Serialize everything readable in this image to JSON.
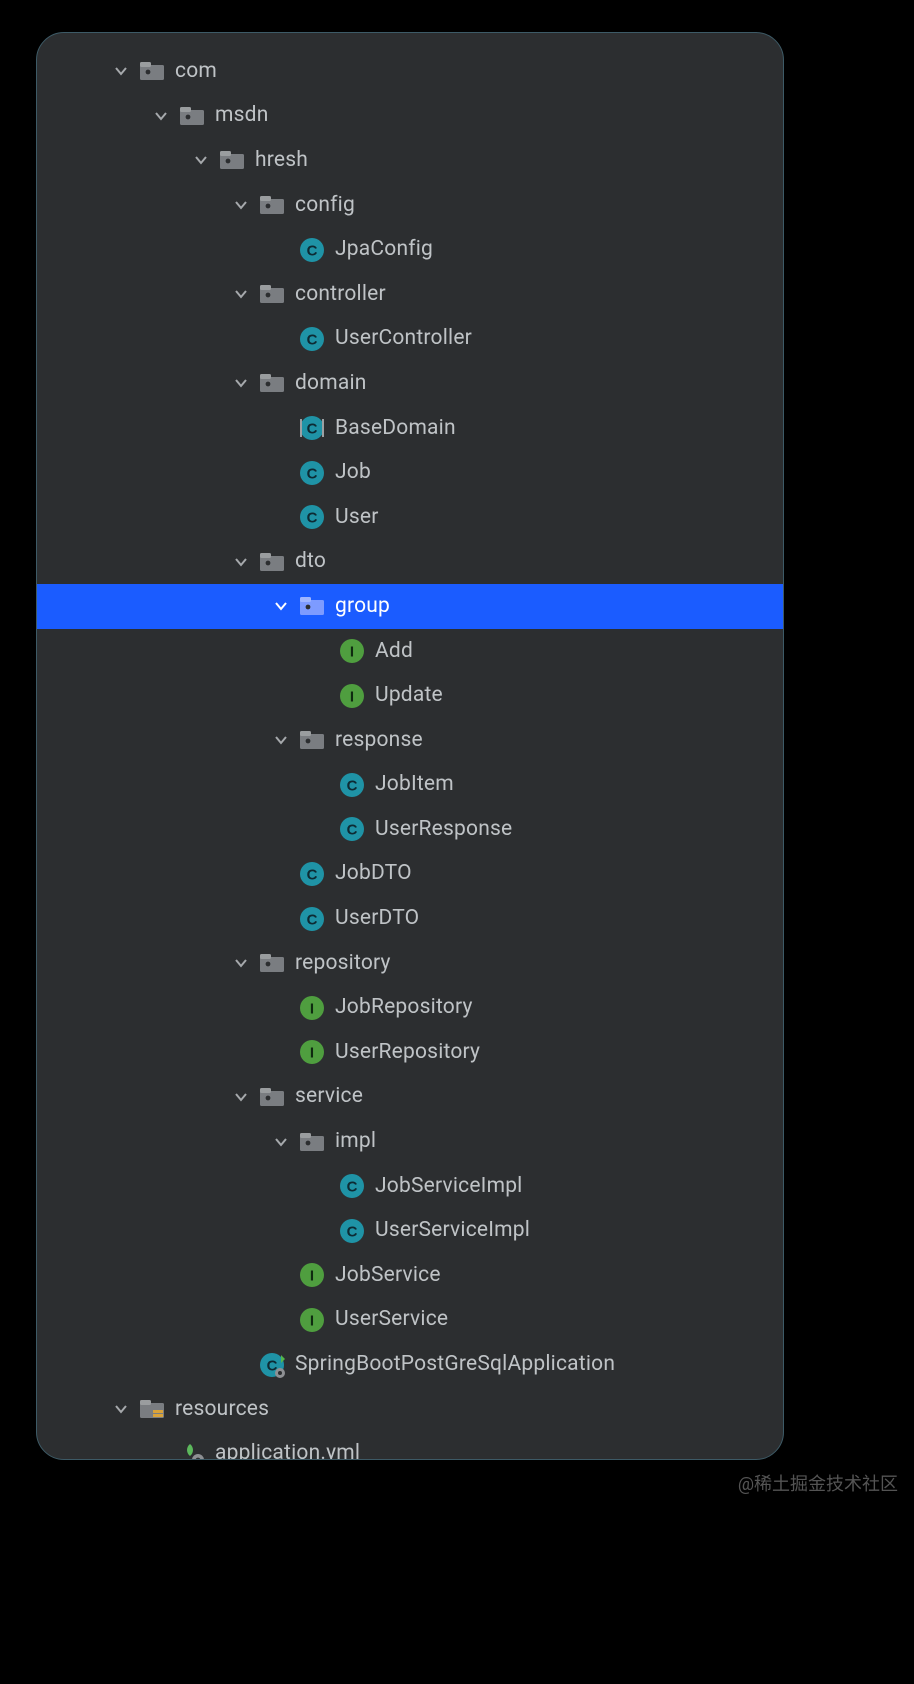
{
  "watermark": "@稀土掘金技术社区",
  "indentBase": 72,
  "indentStep": 40,
  "rows": [
    {
      "depth": 0,
      "type": "folder",
      "label": "com",
      "expanded": true
    },
    {
      "depth": 1,
      "type": "folder",
      "label": "msdn",
      "expanded": true
    },
    {
      "depth": 2,
      "type": "folder",
      "label": "hresh",
      "expanded": true
    },
    {
      "depth": 3,
      "type": "folder",
      "label": "config",
      "expanded": true
    },
    {
      "depth": 4,
      "type": "class",
      "label": "JpaConfig"
    },
    {
      "depth": 3,
      "type": "folder",
      "label": "controller",
      "expanded": true
    },
    {
      "depth": 4,
      "type": "class",
      "label": "UserController"
    },
    {
      "depth": 3,
      "type": "folder",
      "label": "domain",
      "expanded": true
    },
    {
      "depth": 4,
      "type": "abstract",
      "label": "BaseDomain"
    },
    {
      "depth": 4,
      "type": "class",
      "label": "Job"
    },
    {
      "depth": 4,
      "type": "class",
      "label": "User"
    },
    {
      "depth": 3,
      "type": "folder",
      "label": "dto",
      "expanded": true
    },
    {
      "depth": 4,
      "type": "folder",
      "label": "group",
      "expanded": true,
      "selected": true
    },
    {
      "depth": 5,
      "type": "interface",
      "label": "Add"
    },
    {
      "depth": 5,
      "type": "interface",
      "label": "Update"
    },
    {
      "depth": 4,
      "type": "folder",
      "label": "response",
      "expanded": true
    },
    {
      "depth": 5,
      "type": "class",
      "label": "JobItem"
    },
    {
      "depth": 5,
      "type": "class",
      "label": "UserResponse"
    },
    {
      "depth": 4,
      "type": "class",
      "label": "JobDTO"
    },
    {
      "depth": 4,
      "type": "class",
      "label": "UserDTO"
    },
    {
      "depth": 3,
      "type": "folder",
      "label": "repository",
      "expanded": true
    },
    {
      "depth": 4,
      "type": "interface",
      "label": "JobRepository"
    },
    {
      "depth": 4,
      "type": "interface",
      "label": "UserRepository"
    },
    {
      "depth": 3,
      "type": "folder",
      "label": "service",
      "expanded": true
    },
    {
      "depth": 4,
      "type": "folder",
      "label": "impl",
      "expanded": true
    },
    {
      "depth": 5,
      "type": "class",
      "label": "JobServiceImpl"
    },
    {
      "depth": 5,
      "type": "class",
      "label": "UserServiceImpl"
    },
    {
      "depth": 4,
      "type": "interface",
      "label": "JobService"
    },
    {
      "depth": 4,
      "type": "interface",
      "label": "UserService"
    },
    {
      "depth": 3,
      "type": "springboot",
      "label": "SpringBootPostGreSqlApplication"
    },
    {
      "depth": 0,
      "type": "resources",
      "label": "resources",
      "expanded": true
    },
    {
      "depth": 1,
      "type": "yml",
      "label": "application.yml"
    }
  ]
}
